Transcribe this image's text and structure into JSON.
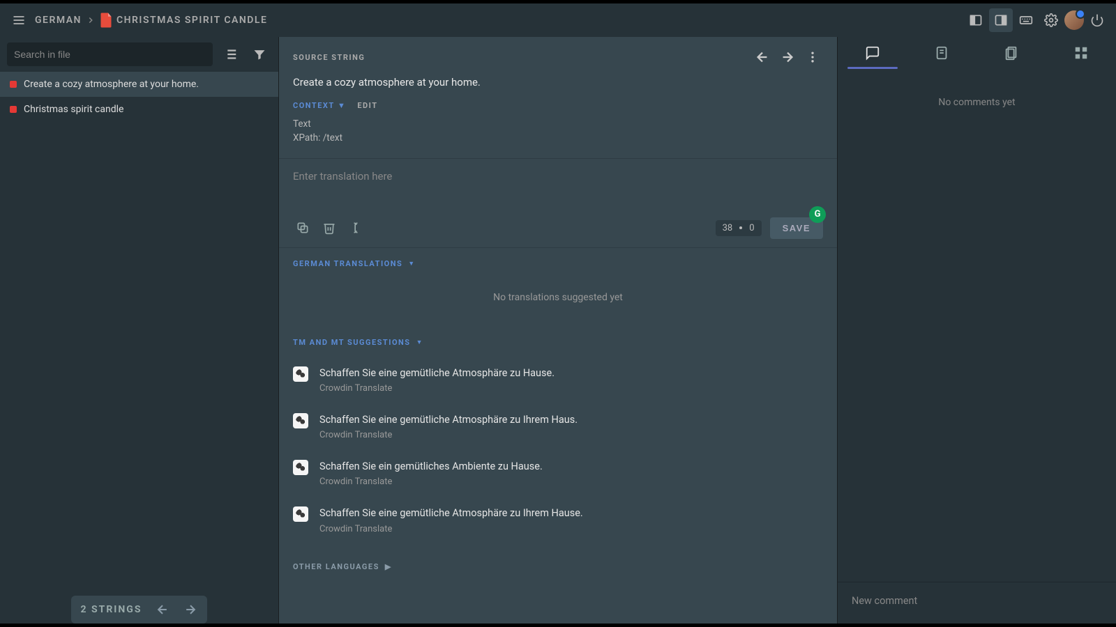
{
  "header": {
    "language": "GERMAN",
    "file_name": "CHRISTMAS SPIRIT CANDLE"
  },
  "left": {
    "search_placeholder": "Search in file",
    "strings": [
      {
        "text": "Create a cozy atmosphere at your home."
      },
      {
        "text": "Christmas spirit candle"
      }
    ],
    "footer_label": "2 STRINGS"
  },
  "center": {
    "source_label": "SOURCE STRING",
    "source_text": "Create a cozy atmosphere at your home.",
    "context_label": "CONTEXT",
    "edit_label": "EDIT",
    "context_line1": "Text",
    "context_line2": "XPath: /text",
    "translation_placeholder": "Enter translation here",
    "counter_source": "38",
    "counter_target": "0",
    "save_label": "SAVE",
    "translations_header": "GERMAN TRANSLATIONS",
    "no_translations": "No translations suggested yet",
    "tm_header": "TM AND MT SUGGESTIONS",
    "suggestions": [
      {
        "text": "Schaffen Sie eine gemütliche Atmosphäre zu Hause.",
        "source": "Crowdin Translate"
      },
      {
        "text": "Schaffen Sie eine gemütliche Atmosphäre zu Ihrem Haus.",
        "source": "Crowdin Translate"
      },
      {
        "text": "Schaffen Sie ein gemütliches Ambiente zu Hause.",
        "source": "Crowdin Translate"
      },
      {
        "text": "Schaffen Sie eine gemütliche Atmosphäre zu Ihrem Hause.",
        "source": "Crowdin Translate"
      }
    ],
    "other_languages_label": "OTHER LANGUAGES"
  },
  "right": {
    "no_comments": "No comments yet",
    "new_comment_placeholder": "New comment"
  }
}
